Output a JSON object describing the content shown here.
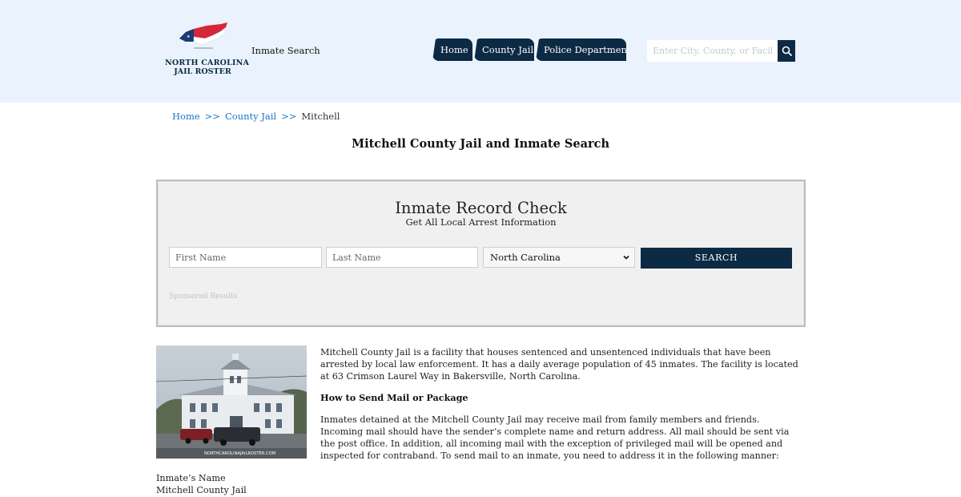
{
  "header": {
    "logo_line1": "NORTH CAROLINA",
    "logo_line2": "JAIL ROSTER",
    "site_name": "Inmate Search",
    "nav": [
      "Home",
      "County Jails",
      "Police Departments"
    ],
    "search_placeholder": "Enter City, County, or Facility"
  },
  "breadcrumb": {
    "items": [
      "Home",
      "County Jail",
      "Mitchell"
    ],
    "separator": ">>"
  },
  "page_title": "Mitchell County Jail and Inmate Search",
  "record_check": {
    "title": "Inmate Record Check",
    "subtitle": "Get All Local Arrest Information",
    "first_name_placeholder": "First Name",
    "last_name_placeholder": "Last Name",
    "state_selected": "North Carolina",
    "search_label": "SEARCH",
    "sponsored": "Sponsored Results"
  },
  "photo": {
    "watermark": "NORTHCAROLINAJAILROSTER.COM"
  },
  "content": {
    "intro": "Mitchell County Jail is a facility that houses sentenced and unsentenced individuals that have been arrested by local law enforcement. It has a daily average population of 45 inmates. The facility is located at 63 Crimson Laurel Way in Bakersville, North Carolina.",
    "mail_heading": "How to Send Mail or Package",
    "mail_text": "Inmates detained at the Mitchell County Jail may receive mail from family members and friends. Incoming mail should have the sender’s complete name and return address. All mail should be sent via the post office. In addition, all incoming mail with the exception of privileged mail will be opened and inspected for contraband. To send mail to an inmate, you need to address it in the following manner:"
  },
  "address": {
    "line1": "Inmate’s Name",
    "line2": "Mitchell County Jail"
  },
  "colors": {
    "header_bg": "#eaf3fd",
    "navy": "#0d2a44",
    "link": "#1a73c8",
    "panel_bg": "#f0f0f0"
  },
  "icons": [
    "nc-flag-map-icon",
    "search-icon",
    "chevron-down-icon"
  ]
}
